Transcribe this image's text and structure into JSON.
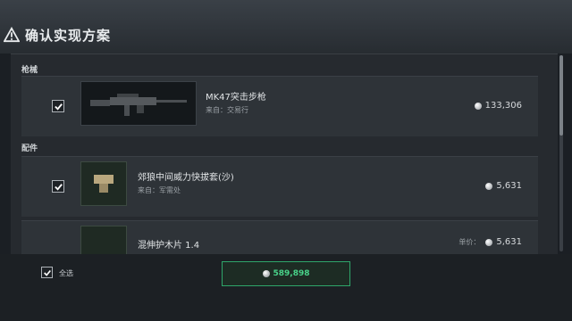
{
  "header": {
    "title": "确认实现方案",
    "icon": "warning-icon"
  },
  "sections": [
    {
      "label": "枪械",
      "items": [
        {
          "name": "MK47突击步枪",
          "source": "来自：交易行",
          "price": "133,306",
          "checked": true
        }
      ]
    },
    {
      "label": "配件",
      "items": [
        {
          "name": "郊狼中间威力快拔套(沙)",
          "source": "来自：军需处",
          "price": "5,631",
          "checked": true
        },
        {
          "name": "混伸护木片 1.4",
          "source": "",
          "price_label": "单价：",
          "price": "5,631",
          "checked": true
        }
      ]
    }
  ],
  "footer": {
    "select_all_label": "全选",
    "total": "589,898"
  },
  "colors": {
    "accent_green": "#2ea66a",
    "background": "#1b1f24",
    "row": "#2e3338"
  }
}
